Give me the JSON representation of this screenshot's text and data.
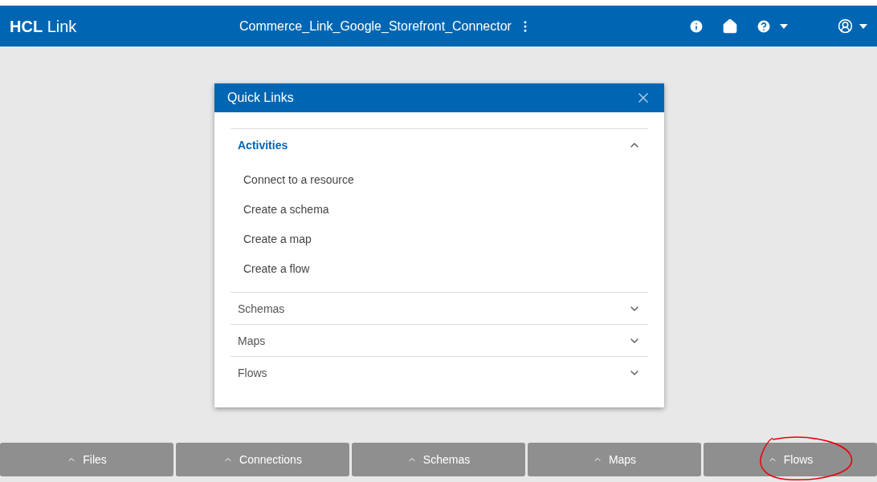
{
  "header": {
    "brand_bold": "HCL",
    "brand_rest": "Link",
    "project": "Commerce_Link_Google_Storefront_Connector"
  },
  "dialog": {
    "title": "Quick Links",
    "sections": [
      {
        "label": "Activities",
        "expanded": true,
        "links": [
          "Connect to a resource",
          "Create a schema",
          "Create a map",
          "Create a flow"
        ]
      },
      {
        "label": "Schemas",
        "expanded": false
      },
      {
        "label": "Maps",
        "expanded": false
      },
      {
        "label": "Flows",
        "expanded": false
      }
    ]
  },
  "bottom_tabs": [
    {
      "label": "Files",
      "circled": false
    },
    {
      "label": "Connections",
      "circled": false
    },
    {
      "label": "Schemas",
      "circled": false
    },
    {
      "label": "Maps",
      "circled": false
    },
    {
      "label": "Flows",
      "circled": true
    }
  ]
}
